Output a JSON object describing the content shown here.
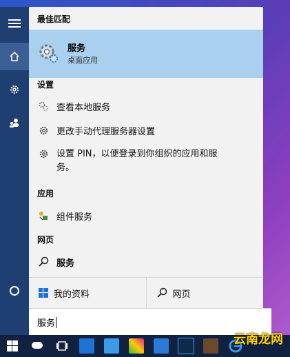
{
  "sections": {
    "best_match": "最佳匹配",
    "settings": "设置",
    "apps": "应用",
    "web": "网页"
  },
  "best_match_item": {
    "title": "服务",
    "subtitle": "桌面应用",
    "icon": "gear-services-icon"
  },
  "settings_items": [
    {
      "label": "查看本地服务",
      "icon": "services-icon"
    },
    {
      "label": "更改手动代理服务器设置",
      "icon": "gear-icon"
    },
    {
      "label_line1": "设置 PIN，以便登录到你组织的应用和服",
      "label_line2": "务。",
      "icon": "gear-icon"
    }
  ],
  "app_items": [
    {
      "label": "组件服务",
      "icon": "component-services-icon"
    }
  ],
  "web_items": [
    {
      "label": "服务",
      "icon": "search-icon"
    }
  ],
  "bottom_buttons": {
    "my_stuff": "我的资料",
    "web": "网页"
  },
  "search_box": {
    "value": "服务"
  },
  "watermark": "云南龙网",
  "colors": {
    "rail": "#1f3f73",
    "highlight": "#a9d0ef",
    "taskbar": "#10223f"
  }
}
